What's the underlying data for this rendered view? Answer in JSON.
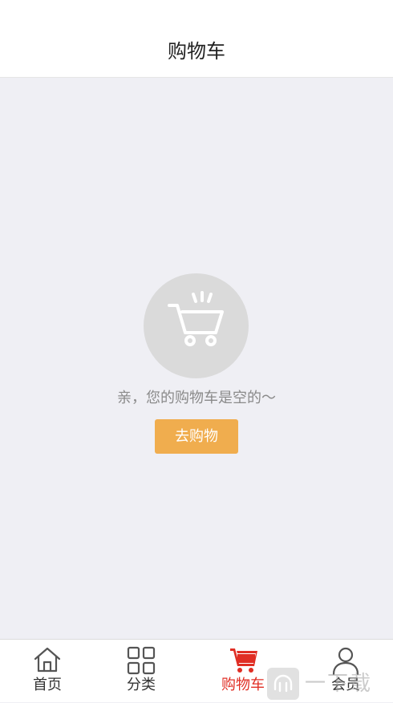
{
  "header": {
    "title": "购物车"
  },
  "empty_state": {
    "icon": "cart-icon",
    "message": "亲，您的购物车是空的～",
    "button_label": "去购物"
  },
  "tabbar": {
    "tabs": [
      {
        "label": "首页",
        "icon": "home-icon",
        "active": false
      },
      {
        "label": "分类",
        "icon": "grid-icon",
        "active": false
      },
      {
        "label": "购物车",
        "icon": "cart-icon",
        "active": true
      },
      {
        "label": "会员",
        "icon": "user-icon",
        "active": false
      }
    ]
  },
  "watermark": {
    "text": "一下载"
  },
  "colors": {
    "accent": "#e02e24",
    "button": "#f0ad4e",
    "background": "#efeff4"
  }
}
